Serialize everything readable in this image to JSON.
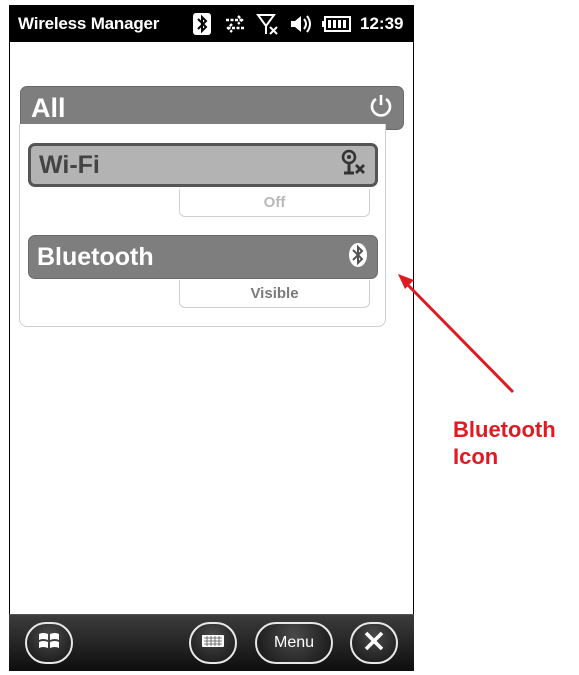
{
  "status_bar": {
    "app_title": "Wireless Manager",
    "clock": "12:39",
    "icons": [
      "bluetooth-icon",
      "data-transfer-icon",
      "no-signal-icon",
      "volume-icon",
      "battery-icon"
    ]
  },
  "all_section": {
    "label": "All",
    "icon": "power-icon"
  },
  "radios": [
    {
      "label": "Wi-Fi",
      "status": "Off",
      "icon": "wifi-off-icon"
    },
    {
      "label": "Bluetooth",
      "status": "Visible",
      "icon": "bluetooth-icon"
    }
  ],
  "softkeys": {
    "menu_label": "Menu",
    "icons": [
      "windows-start-icon",
      "keyboard-icon",
      "close-icon"
    ]
  },
  "annotation": {
    "line1": "Bluetooth",
    "line2": "Icon",
    "color": "#e01a22"
  }
}
